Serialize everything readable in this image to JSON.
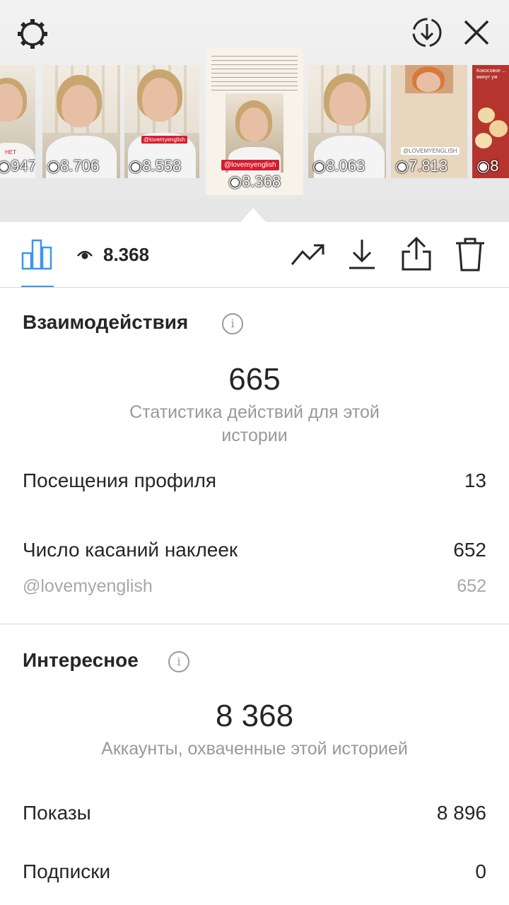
{
  "stories": [
    {
      "views": "947",
      "note": "НЕТ"
    },
    {
      "views": "8.706"
    },
    {
      "views": "8.558",
      "tag": "@lovemyenglish"
    },
    {
      "views": "8.368",
      "tag": "@lovemyenglish",
      "selected": true
    },
    {
      "views": "8.063"
    },
    {
      "views": "7.813",
      "tag": "@LOVEMYENGLISH"
    },
    {
      "views": "8",
      "title": "Кокосовое ... минут уж"
    }
  ],
  "toolbar": {
    "views": "8.368"
  },
  "interactions": {
    "title": "Взаимодействия",
    "total": "665",
    "total_caption": "Статистика действий для этой истории",
    "rows": [
      {
        "label": "Посещения профиля",
        "value": "13"
      },
      {
        "label": "Число касаний наклеек",
        "value": "652"
      },
      {
        "label": "@lovemyenglish",
        "value": "652"
      }
    ]
  },
  "discovery": {
    "title": "Интересное",
    "total": "8 368",
    "total_caption": "Аккаунты, охваченные этой историей",
    "rows": [
      {
        "label": "Показы",
        "value": "8 896"
      },
      {
        "label": "Подписки",
        "value": "0"
      }
    ]
  },
  "colors": {
    "accent": "#3897f0",
    "tag_red": "#d81b2e",
    "muted_text": "#999999"
  }
}
